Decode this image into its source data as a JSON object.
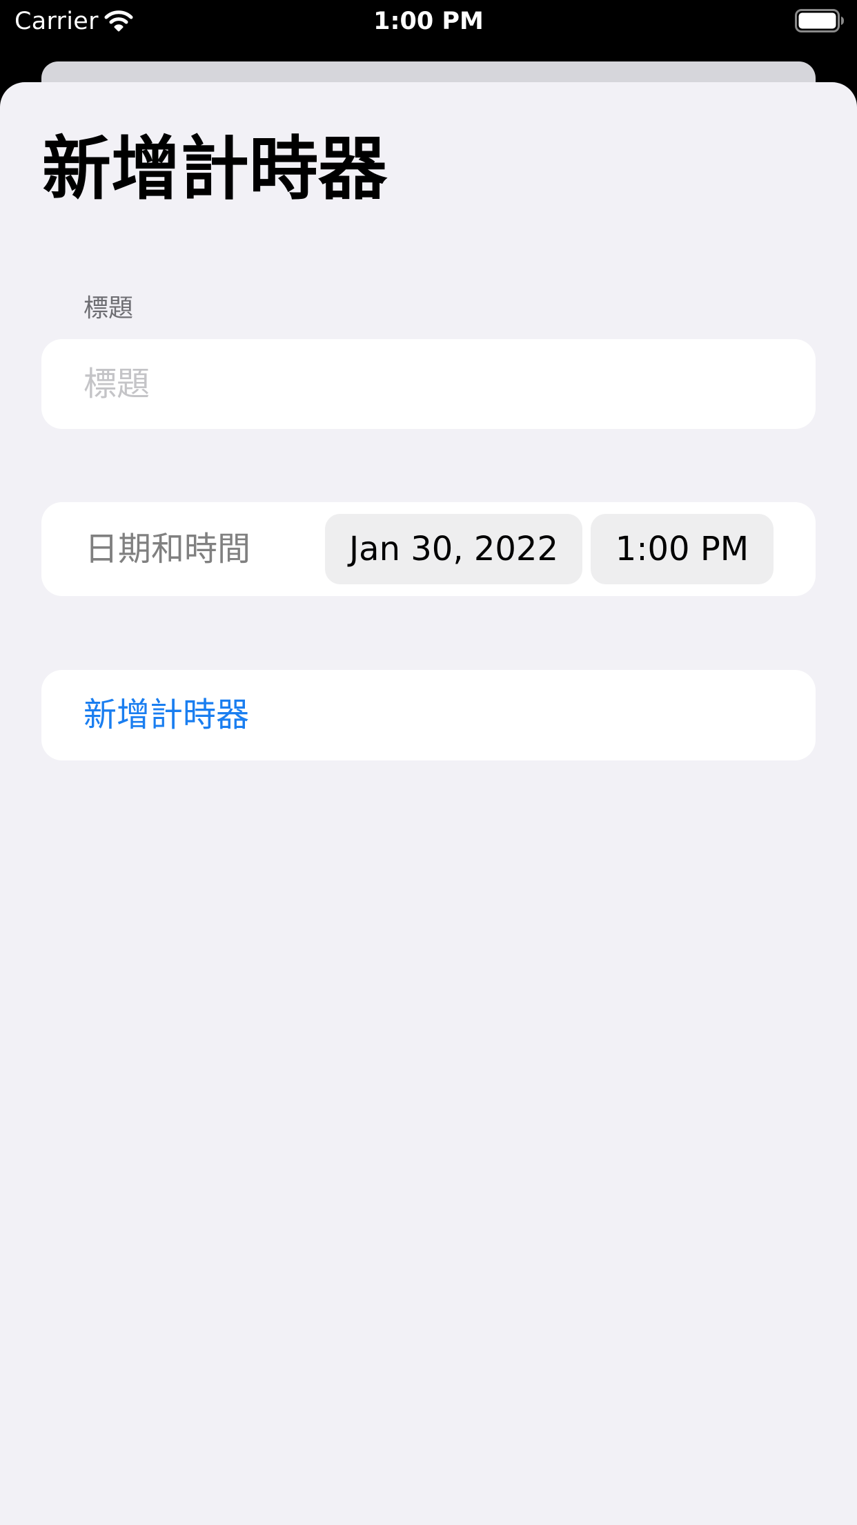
{
  "status_bar": {
    "carrier": "Carrier",
    "time": "1:00 PM",
    "icons": [
      "wifi-icon",
      "battery-icon"
    ]
  },
  "page": {
    "title": "新增計時器"
  },
  "title_section": {
    "header": "標題",
    "placeholder": "標題",
    "value": ""
  },
  "datetime": {
    "label": "日期和時間",
    "date": "Jan 30, 2022",
    "time": "1:00 PM"
  },
  "action": {
    "label": "新增計時器"
  },
  "colors": {
    "accent": "#1a7ef0",
    "background": "#f2f1f6",
    "card": "#ffffff",
    "pill": "#eeeeef",
    "secondary_text": "#808080"
  }
}
